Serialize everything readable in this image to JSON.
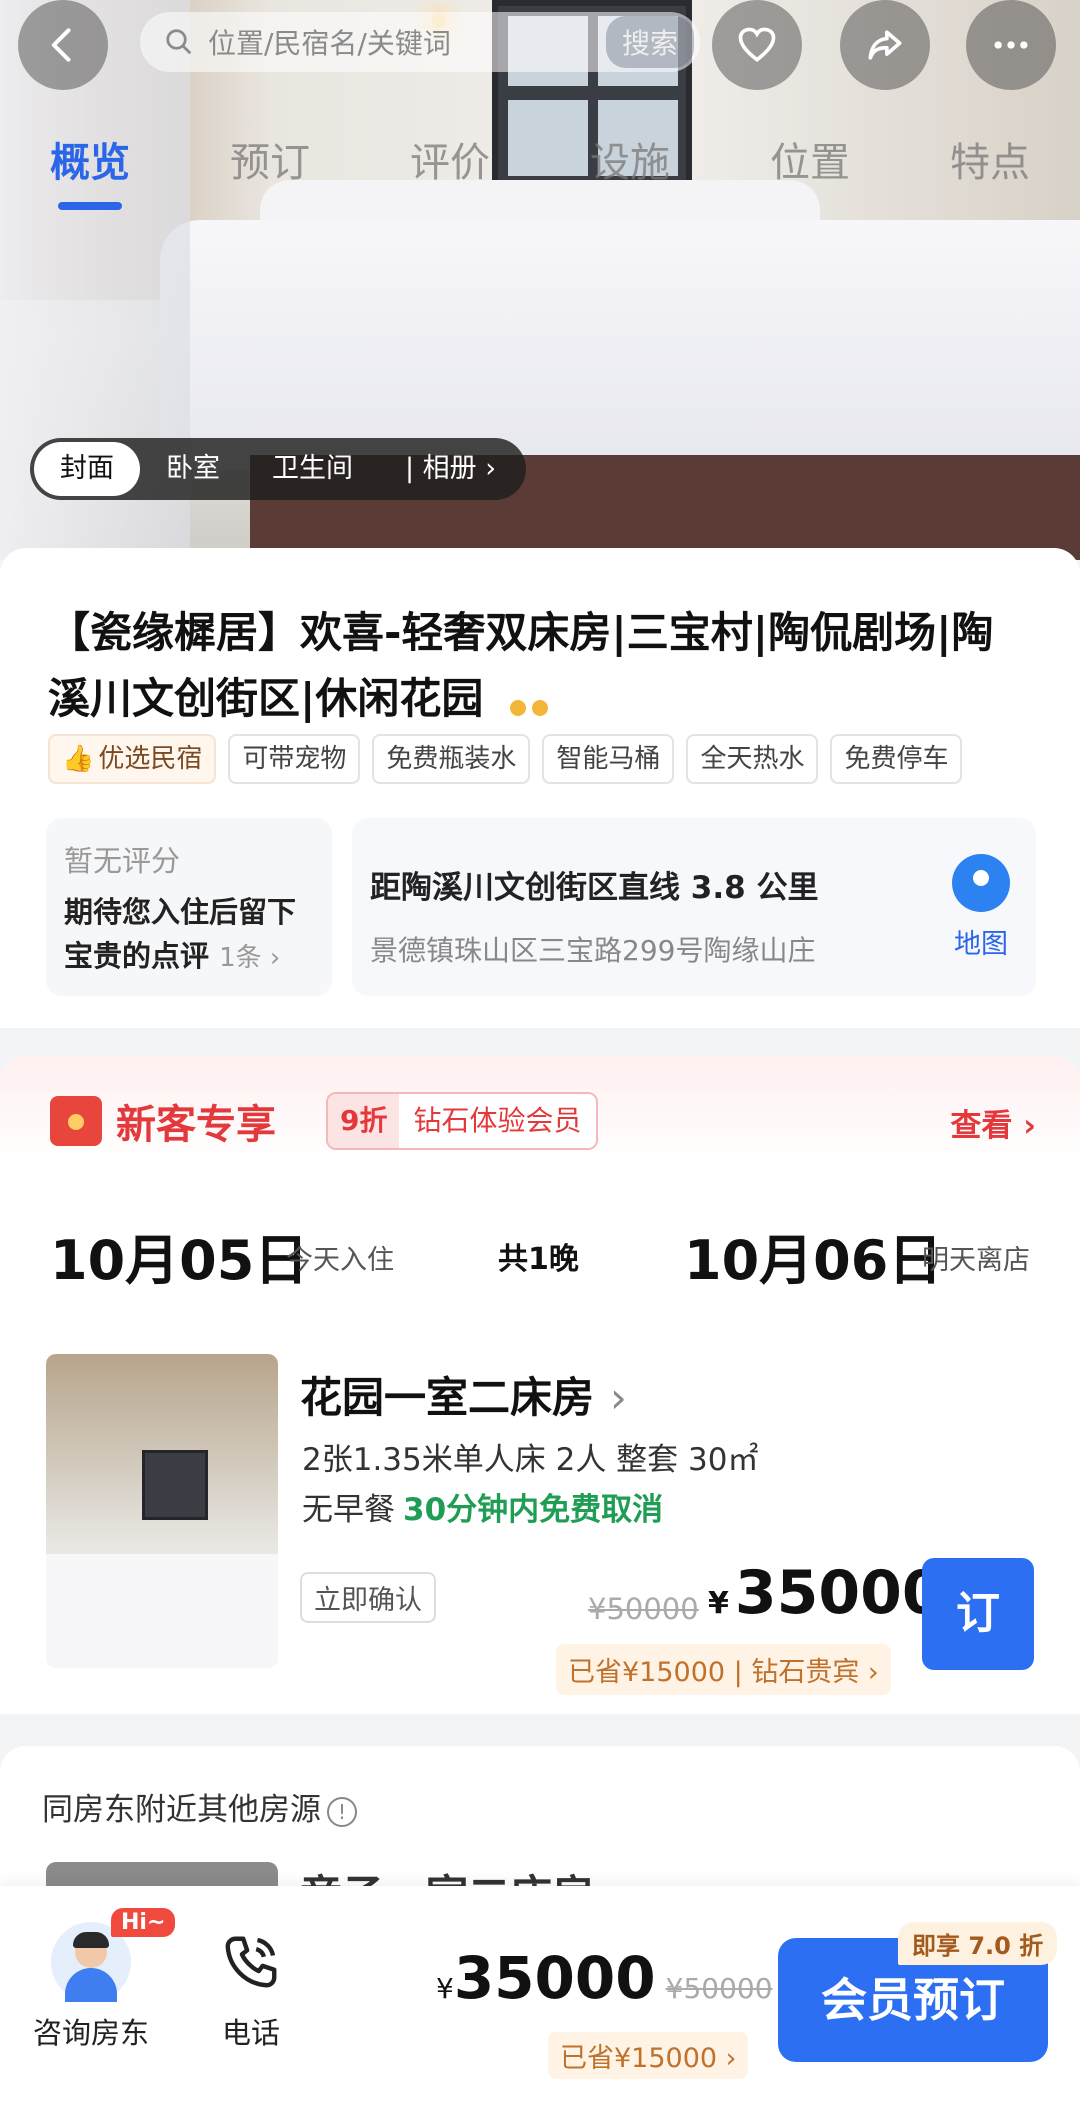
{
  "search": {
    "placeholder": "位置/民宿名/关键词",
    "button": "搜索"
  },
  "tabs": [
    "概览",
    "预订",
    "评价",
    "设施",
    "位置",
    "特点"
  ],
  "photo_categories": [
    "封面",
    "卧室",
    "卫生间",
    "| 相册 ›"
  ],
  "listing": {
    "title": "【瓷缘樨居】欢喜-轻奢双床房|三宝村|陶侃剧场|陶溪川文创街区|休闲花园",
    "tags": [
      "优选民宿",
      "可带宠物",
      "免费瓶装水",
      "智能马桶",
      "全天热水",
      "免费停车"
    ]
  },
  "rating": {
    "status": "暂无评分",
    "prompt": "期待您入住后留下宝贵的点评",
    "count": "1条 ›"
  },
  "location": {
    "distance": "距陶溪川文创街区直线 3.8 公里",
    "address": "景德镇珠山区三宝路299号陶缘山庄",
    "map_label": "地图"
  },
  "promo": {
    "title": "新客专享",
    "discount": "9折",
    "member": "钻石体验会员",
    "view": "查看 ›"
  },
  "dates": {
    "checkin": "10月05日",
    "checkin_note": "今天入住",
    "nights": "共1晚",
    "checkout": "10月06日",
    "checkout_note": "明天离店"
  },
  "room": {
    "name": "花园一室二床房",
    "specs": "2张1.35米单人床 2人 整套 30㎡",
    "meal": "无早餐",
    "cancel": "30分钟内免费取消",
    "instant": "立即确认",
    "original_price": "¥50000",
    "currency": "¥",
    "price": "35000",
    "saving": "已省¥15000 | 钻石贵宾 ›",
    "book": "订"
  },
  "other_listings": {
    "title": "同房东附近其他房源",
    "first_name": "竞子一室二床房 ›"
  },
  "bottom_bar": {
    "host_label": "咨询房东",
    "hi_badge": "Hi~",
    "phone_label": "电话",
    "currency": "¥",
    "price": "35000",
    "original_price": "¥50000",
    "saving": "已省¥15000 ›",
    "book": "会员预订",
    "discount_badge": "即享 7.0 折"
  },
  "colors": {
    "accent": "#2c6ff2",
    "promo_red": "#e4393c",
    "cancel_green": "#1f9d55"
  },
  "icons": [
    "back-icon",
    "heart-icon",
    "share-icon",
    "more-icon",
    "search-icon",
    "map-pin-icon",
    "phone-icon"
  ]
}
